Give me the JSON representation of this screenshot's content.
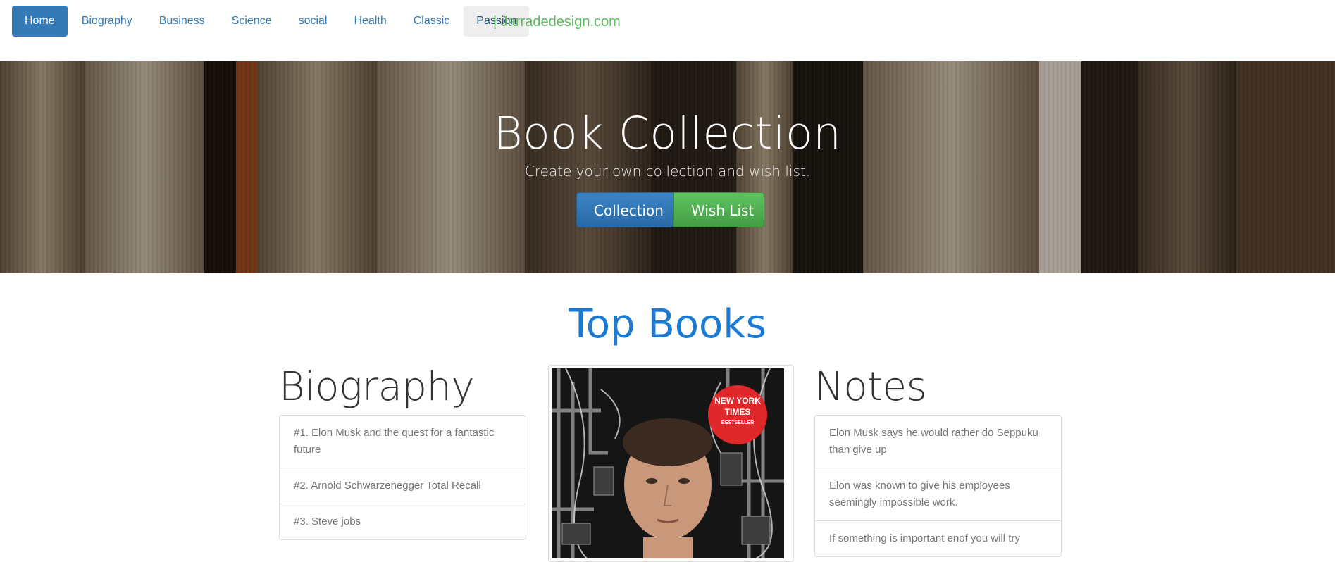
{
  "nav": {
    "items": [
      {
        "label": "Home"
      },
      {
        "label": "Biography"
      },
      {
        "label": "Business"
      },
      {
        "label": "Science"
      },
      {
        "label": "social"
      },
      {
        "label": "Health"
      },
      {
        "label": "Classic"
      },
      {
        "label": "Passion"
      }
    ],
    "brand": "| Jarradedesign.com"
  },
  "hero": {
    "title": "Book Collection",
    "subtitle": "Create your own collection and wish list.",
    "collection_button": "Collection",
    "wishlist_button": "Wish List"
  },
  "main": {
    "title": "Top Books",
    "biography": {
      "heading": "Biography",
      "items": [
        "#1. Elon Musk and the quest for a fantastic future",
        "#2. Arnold Schwarzenegger Total Recall",
        "#3. Steve jobs"
      ]
    },
    "cover": {
      "badge_line1": "NEW YORK",
      "badge_line2": "TIMES",
      "badge_line3": "BESTSELLER"
    },
    "notes": {
      "heading": "Notes",
      "items": [
        "Elon Musk says he would rather do Seppuku than give up",
        "Elon was known to give his employees seemingly impossible work.",
        "If something is important enof you will try"
      ]
    }
  }
}
